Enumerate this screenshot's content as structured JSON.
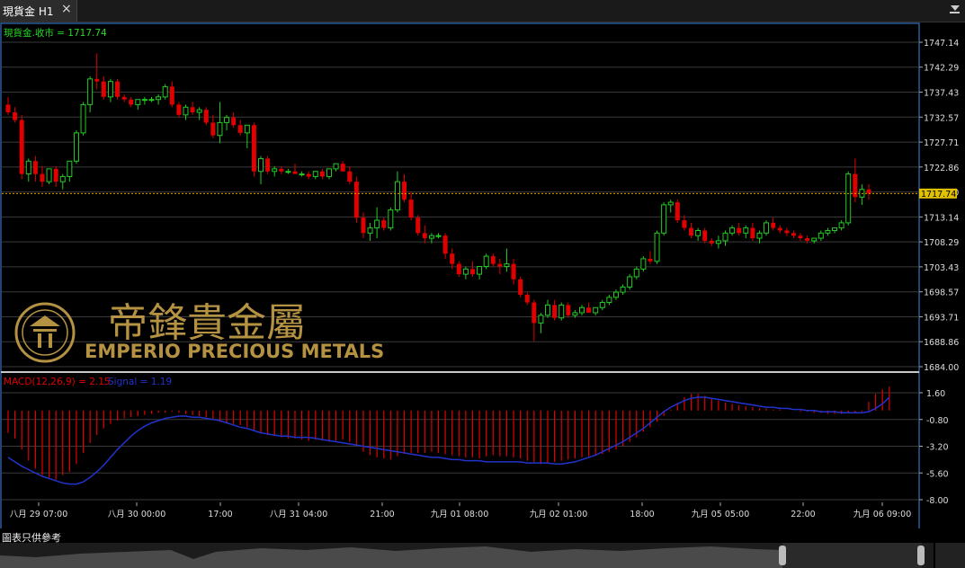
{
  "tab": {
    "title": "現貨金 H1",
    "close_label": "×"
  },
  "price_panel": {
    "legend": "現貨金.收市 = 1717.74",
    "current_price": "1717.74",
    "price_labels": [
      "1747.14",
      "1742.29",
      "1737.43",
      "1732.57",
      "1727.71",
      "1722.86",
      "1718.00",
      "1713.14",
      "1708.29",
      "1703.43",
      "1698.57",
      "1693.71",
      "1688.86",
      "1684.00"
    ]
  },
  "macd_panel": {
    "legend_macd": "MACD(12,26,9) = 2.15",
    "legend_signal": "Signal = 1.19",
    "labels": [
      "1.60",
      "-0.80",
      "-3.20",
      "-5.60",
      "-8.00"
    ]
  },
  "time_axis": {
    "labels": [
      "八月 29 07:00",
      "八月 30 00:00",
      "17:00",
      "八月 31 04:00",
      "21:00",
      "九月 01 08:00",
      "九月 02 01:00",
      "18:00",
      "九月 05 05:00",
      "22:00",
      "九月 06 09:00"
    ]
  },
  "watermark": {
    "chinese": "帝鋒貴金屬",
    "english": "EMPERIO PRECIOUS METALS"
  },
  "footer": {
    "disclaimer": "圖表只供參考"
  },
  "colors": {
    "up": "#22cc22",
    "down": "#e00000",
    "signal": "#2233cc",
    "grid": "#3a3a3a",
    "price_line": "#e0a000"
  },
  "chart_data": {
    "type": "candlestick",
    "y_range": [
      1684.0,
      1747.14
    ],
    "macd_range": [
      -8.0,
      1.6
    ],
    "candles": [
      [
        1735.0,
        1736.5,
        1733.0,
        1733.5
      ],
      [
        1733.5,
        1734.5,
        1731.5,
        1732.0
      ],
      [
        1732.0,
        1733.0,
        1720.5,
        1721.5
      ],
      [
        1721.5,
        1724.5,
        1720.0,
        1724.0
      ],
      [
        1724.0,
        1725.0,
        1720.0,
        1721.5
      ],
      [
        1721.5,
        1723.0,
        1719.0,
        1720.0
      ],
      [
        1720.0,
        1722.5,
        1719.5,
        1722.5
      ],
      [
        1722.5,
        1723.0,
        1719.0,
        1720.0
      ],
      [
        1720.0,
        1721.5,
        1718.5,
        1721.0
      ],
      [
        1721.0,
        1724.0,
        1720.0,
        1724.0
      ],
      [
        1724.0,
        1730.0,
        1723.5,
        1729.5
      ],
      [
        1729.5,
        1735.5,
        1729.0,
        1735.0
      ],
      [
        1735.0,
        1740.5,
        1733.5,
        1740.0
      ],
      [
        1740.0,
        1745.0,
        1738.0,
        1739.5
      ],
      [
        1739.5,
        1740.5,
        1736.0,
        1736.5
      ],
      [
        1736.5,
        1740.0,
        1735.5,
        1739.5
      ],
      [
        1739.5,
        1740.0,
        1736.0,
        1736.5
      ],
      [
        1736.5,
        1737.0,
        1735.5,
        1736.0
      ],
      [
        1736.0,
        1736.5,
        1734.5,
        1735.0
      ],
      [
        1735.0,
        1736.0,
        1734.0,
        1736.0
      ],
      [
        1736.0,
        1736.5,
        1735.0,
        1736.0
      ],
      [
        1736.0,
        1736.5,
        1735.5,
        1736.0
      ],
      [
        1736.0,
        1737.0,
        1735.0,
        1736.5
      ],
      [
        1736.5,
        1739.0,
        1736.0,
        1738.5
      ],
      [
        1738.5,
        1739.5,
        1734.5,
        1735.0
      ],
      [
        1735.0,
        1735.5,
        1732.5,
        1733.0
      ],
      [
        1733.0,
        1735.0,
        1732.0,
        1734.5
      ],
      [
        1734.5,
        1735.5,
        1733.0,
        1733.5
      ],
      [
        1733.5,
        1734.5,
        1732.0,
        1734.0
      ],
      [
        1734.0,
        1734.5,
        1731.0,
        1731.5
      ],
      [
        1731.5,
        1733.0,
        1728.5,
        1729.0
      ],
      [
        1729.0,
        1735.5,
        1727.5,
        1731.5
      ],
      [
        1731.5,
        1733.0,
        1730.0,
        1732.5
      ],
      [
        1732.5,
        1733.5,
        1730.5,
        1731.0
      ],
      [
        1731.0,
        1732.0,
        1729.0,
        1729.5
      ],
      [
        1729.5,
        1731.0,
        1726.5,
        1731.0
      ],
      [
        1731.0,
        1731.5,
        1721.0,
        1722.0
      ],
      [
        1722.0,
        1725.0,
        1719.5,
        1724.5
      ],
      [
        1724.5,
        1725.0,
        1721.5,
        1722.0
      ],
      [
        1722.0,
        1723.0,
        1721.0,
        1722.5
      ],
      [
        1722.5,
        1723.0,
        1721.5,
        1722.0
      ],
      [
        1722.0,
        1722.5,
        1721.5,
        1722.0
      ],
      [
        1722.0,
        1723.5,
        1721.5,
        1721.5
      ],
      [
        1721.5,
        1722.0,
        1721.0,
        1721.5
      ],
      [
        1721.5,
        1722.0,
        1720.5,
        1721.0
      ],
      [
        1721.0,
        1722.0,
        1720.5,
        1722.0
      ],
      [
        1722.0,
        1722.5,
        1720.5,
        1721.0
      ],
      [
        1721.0,
        1722.5,
        1720.5,
        1722.5
      ],
      [
        1722.5,
        1723.5,
        1722.0,
        1723.5
      ],
      [
        1723.5,
        1724.0,
        1722.0,
        1722.0
      ],
      [
        1722.0,
        1723.0,
        1719.5,
        1720.0
      ],
      [
        1720.0,
        1721.0,
        1712.0,
        1713.0
      ],
      [
        1713.0,
        1714.0,
        1709.0,
        1710.0
      ],
      [
        1710.0,
        1712.0,
        1708.5,
        1711.0
      ],
      [
        1711.0,
        1715.0,
        1709.0,
        1712.5
      ],
      [
        1712.5,
        1713.0,
        1710.5,
        1711.0
      ],
      [
        1711.0,
        1715.0,
        1710.5,
        1714.5
      ],
      [
        1714.5,
        1722.0,
        1714.0,
        1720.0
      ],
      [
        1720.0,
        1721.5,
        1716.0,
        1716.5
      ],
      [
        1716.5,
        1718.0,
        1712.5,
        1713.0
      ],
      [
        1713.0,
        1713.5,
        1709.5,
        1710.0
      ],
      [
        1710.0,
        1711.5,
        1708.0,
        1709.0
      ],
      [
        1709.0,
        1710.0,
        1708.0,
        1709.5
      ],
      [
        1709.5,
        1710.0,
        1709.0,
        1709.5
      ],
      [
        1709.5,
        1710.0,
        1705.0,
        1706.0
      ],
      [
        1706.0,
        1707.0,
        1703.0,
        1704.0
      ],
      [
        1704.0,
        1704.5,
        1701.5,
        1702.0
      ],
      [
        1702.0,
        1703.5,
        1701.0,
        1703.0
      ],
      [
        1703.0,
        1704.5,
        1701.5,
        1702.0
      ],
      [
        1702.0,
        1703.5,
        1701.0,
        1703.5
      ],
      [
        1703.5,
        1706.0,
        1703.0,
        1705.5
      ],
      [
        1705.5,
        1706.0,
        1703.5,
        1704.0
      ],
      [
        1704.0,
        1705.0,
        1702.0,
        1703.5
      ],
      [
        1703.5,
        1707.0,
        1702.5,
        1704.0
      ],
      [
        1704.0,
        1705.0,
        1700.0,
        1701.0
      ],
      [
        1701.0,
        1701.5,
        1697.5,
        1698.0
      ],
      [
        1698.0,
        1698.5,
        1696.0,
        1696.5
      ],
      [
        1696.5,
        1697.0,
        1689.0,
        1692.5
      ],
      [
        1692.5,
        1694.5,
        1690.5,
        1694.0
      ],
      [
        1694.0,
        1697.0,
        1693.5,
        1696.0
      ],
      [
        1696.0,
        1697.0,
        1693.0,
        1693.5
      ],
      [
        1693.5,
        1696.5,
        1693.0,
        1696.0
      ],
      [
        1696.0,
        1696.5,
        1693.5,
        1694.0
      ],
      [
        1694.0,
        1695.0,
        1693.5,
        1694.5
      ],
      [
        1694.5,
        1696.0,
        1694.0,
        1695.5
      ],
      [
        1695.5,
        1696.5,
        1694.5,
        1694.5
      ],
      [
        1694.5,
        1695.5,
        1694.0,
        1695.5
      ],
      [
        1695.5,
        1697.0,
        1695.0,
        1696.5
      ],
      [
        1696.5,
        1698.0,
        1696.0,
        1697.5
      ],
      [
        1697.5,
        1699.0,
        1697.0,
        1698.5
      ],
      [
        1698.5,
        1700.0,
        1698.0,
        1699.5
      ],
      [
        1699.5,
        1702.0,
        1699.0,
        1701.5
      ],
      [
        1701.5,
        1703.5,
        1701.0,
        1703.0
      ],
      [
        1703.0,
        1705.5,
        1702.5,
        1705.0
      ],
      [
        1705.0,
        1706.5,
        1704.0,
        1704.5
      ],
      [
        1704.5,
        1710.5,
        1704.0,
        1710.0
      ],
      [
        1710.0,
        1716.0,
        1709.5,
        1715.5
      ],
      [
        1715.5,
        1716.5,
        1714.0,
        1716.0
      ],
      [
        1716.0,
        1716.5,
        1712.0,
        1712.5
      ],
      [
        1712.5,
        1713.5,
        1710.5,
        1711.0
      ],
      [
        1711.0,
        1712.0,
        1709.0,
        1709.5
      ],
      [
        1709.5,
        1711.0,
        1708.5,
        1710.5
      ],
      [
        1710.5,
        1711.0,
        1708.0,
        1708.5
      ],
      [
        1708.5,
        1709.0,
        1707.5,
        1708.0
      ],
      [
        1708.0,
        1709.5,
        1707.0,
        1708.5
      ],
      [
        1708.5,
        1710.5,
        1707.5,
        1710.0
      ],
      [
        1710.0,
        1711.5,
        1709.5,
        1711.0
      ],
      [
        1711.0,
        1712.0,
        1709.5,
        1710.0
      ],
      [
        1710.0,
        1711.5,
        1709.0,
        1711.0
      ],
      [
        1711.0,
        1712.0,
        1708.5,
        1709.0
      ],
      [
        1709.0,
        1710.5,
        1708.0,
        1710.0
      ],
      [
        1710.0,
        1712.5,
        1709.5,
        1712.0
      ],
      [
        1712.0,
        1713.0,
        1710.5,
        1711.0
      ],
      [
        1711.0,
        1711.5,
        1710.0,
        1710.5
      ],
      [
        1710.5,
        1711.0,
        1709.5,
        1710.0
      ],
      [
        1710.0,
        1710.5,
        1709.0,
        1709.5
      ],
      [
        1709.5,
        1710.0,
        1708.5,
        1709.0
      ],
      [
        1709.0,
        1709.5,
        1708.0,
        1708.5
      ],
      [
        1708.5,
        1709.0,
        1708.0,
        1709.0
      ],
      [
        1709.0,
        1710.5,
        1708.5,
        1710.0
      ],
      [
        1710.0,
        1711.0,
        1709.5,
        1710.5
      ],
      [
        1710.5,
        1711.0,
        1710.0,
        1711.0
      ],
      [
        1711.0,
        1712.5,
        1710.5,
        1712.0
      ],
      [
        1712.0,
        1722.0,
        1711.5,
        1721.5
      ],
      [
        1721.5,
        1724.5,
        1716.0,
        1717.0
      ],
      [
        1717.0,
        1719.5,
        1715.5,
        1718.5
      ],
      [
        1718.5,
        1719.5,
        1716.5,
        1717.7
      ]
    ],
    "macd": [
      -2.0,
      -2.5,
      -3.5,
      -4.5,
      -5.2,
      -5.8,
      -6.0,
      -6.2,
      -5.8,
      -5.5,
      -4.8,
      -3.8,
      -2.9,
      -2.2,
      -1.6,
      -1.2,
      -0.9,
      -0.7,
      -0.6,
      -0.5,
      -0.4,
      -0.3,
      -0.2,
      -0.2,
      -0.1,
      -0.2,
      -0.3,
      -0.4,
      -0.5,
      -0.6,
      -0.8,
      -1.0,
      -1.1,
      -1.2,
      -1.3,
      -1.5,
      -1.8,
      -2.0,
      -2.2,
      -2.3,
      -2.4,
      -2.5,
      -2.5,
      -2.6,
      -2.7,
      -2.6,
      -2.7,
      -2.8,
      -2.7,
      -2.6,
      -2.8,
      -3.2,
      -3.7,
      -4.0,
      -4.2,
      -4.3,
      -4.4,
      -4.1,
      -3.9,
      -3.8,
      -3.8,
      -3.8,
      -3.7,
      -3.8,
      -3.9,
      -4.0,
      -4.1,
      -4.2,
      -4.2,
      -4.3,
      -4.1,
      -4.0,
      -4.1,
      -4.1,
      -4.2,
      -4.3,
      -4.5,
      -4.6,
      -4.8,
      -4.7,
      -4.6,
      -4.5,
      -4.4,
      -4.3,
      -4.2,
      -4.1,
      -4.0,
      -3.9,
      -3.7,
      -3.5,
      -3.2,
      -2.8,
      -2.4,
      -1.9,
      -1.5,
      -1.0,
      -0.5,
      0.1,
      0.7,
      1.2,
      1.5,
      1.5,
      1.3,
      1.1,
      0.9,
      0.7,
      0.6,
      0.5,
      0.4,
      0.3,
      0.2,
      0.2,
      0.1,
      0.1,
      0.0,
      0.0,
      -0.1,
      -0.1,
      -0.2,
      -0.2,
      -0.3,
      -0.3,
      -0.3,
      -0.2,
      -0.2,
      -0.1,
      0.8,
      1.5,
      1.9,
      2.15
    ],
    "signal": [
      -4.2,
      -4.6,
      -5.0,
      -5.3,
      -5.6,
      -5.9,
      -6.1,
      -6.3,
      -6.5,
      -6.6,
      -6.6,
      -6.4,
      -6.0,
      -5.5,
      -4.9,
      -4.2,
      -3.5,
      -2.9,
      -2.3,
      -1.8,
      -1.4,
      -1.1,
      -0.9,
      -0.7,
      -0.6,
      -0.5,
      -0.5,
      -0.6,
      -0.6,
      -0.7,
      -0.8,
      -0.9,
      -1.1,
      -1.3,
      -1.5,
      -1.6,
      -1.8,
      -2.0,
      -2.1,
      -2.2,
      -2.3,
      -2.3,
      -2.4,
      -2.4,
      -2.4,
      -2.5,
      -2.6,
      -2.7,
      -2.8,
      -2.9,
      -3.0,
      -3.1,
      -3.2,
      -3.3,
      -3.4,
      -3.5,
      -3.6,
      -3.7,
      -3.8,
      -3.9,
      -4.0,
      -4.1,
      -4.2,
      -4.2,
      -4.3,
      -4.4,
      -4.4,
      -4.5,
      -4.5,
      -4.5,
      -4.6,
      -4.6,
      -4.6,
      -4.6,
      -4.6,
      -4.6,
      -4.7,
      -4.7,
      -4.7,
      -4.7,
      -4.8,
      -4.8,
      -4.7,
      -4.6,
      -4.4,
      -4.2,
      -4.0,
      -3.7,
      -3.4,
      -3.1,
      -2.8,
      -2.4,
      -2.0,
      -1.6,
      -1.1,
      -0.6,
      -0.1,
      0.3,
      0.6,
      0.9,
      1.1,
      1.2,
      1.2,
      1.1,
      1.0,
      0.9,
      0.8,
      0.7,
      0.6,
      0.5,
      0.4,
      0.3,
      0.3,
      0.2,
      0.2,
      0.1,
      0.1,
      0.0,
      0.0,
      -0.1,
      -0.1,
      -0.1,
      -0.2,
      -0.2,
      -0.2,
      -0.2,
      -0.1,
      0.2,
      0.6,
      1.19
    ]
  }
}
